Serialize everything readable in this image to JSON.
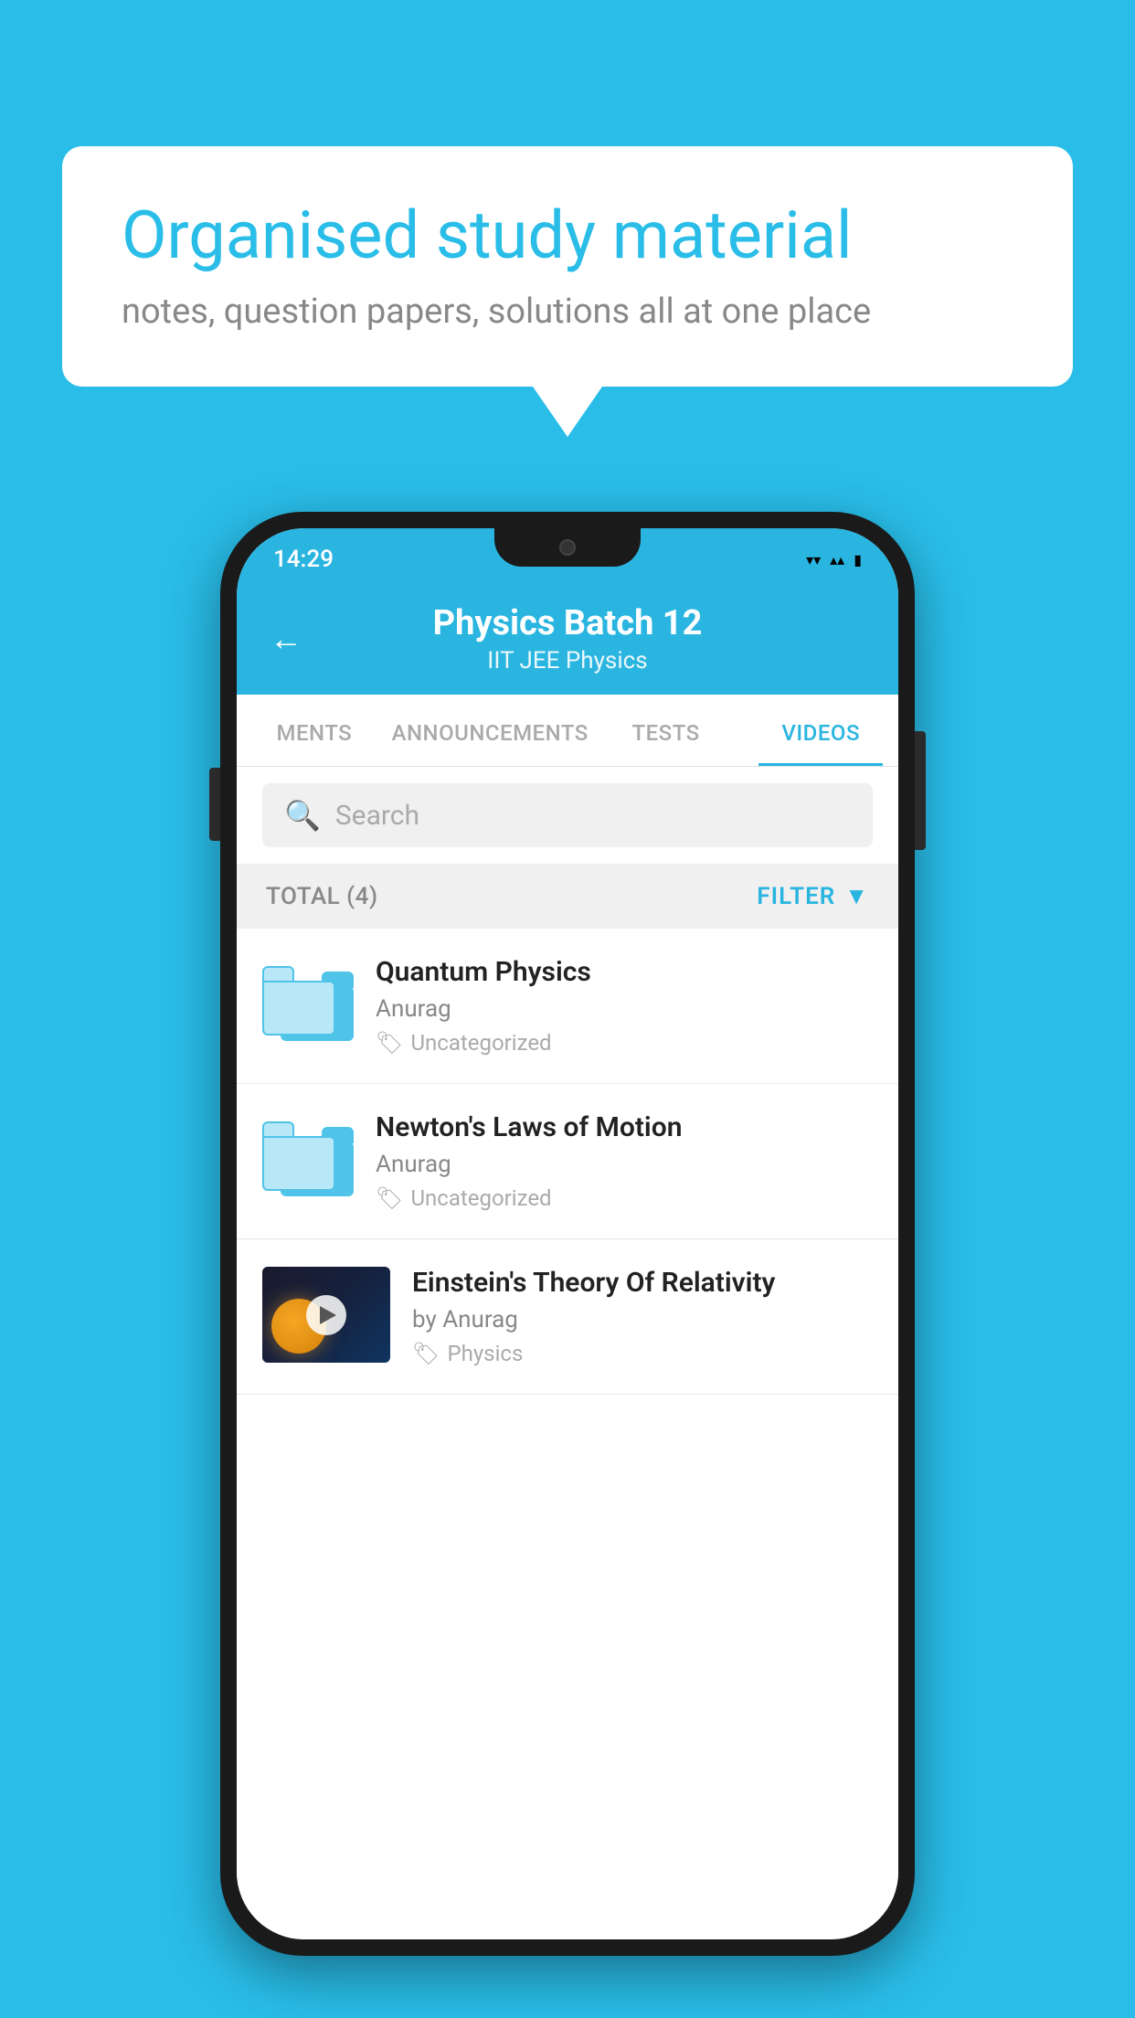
{
  "background": {
    "color": "#29bde8"
  },
  "speech_bubble": {
    "title": "Organised study material",
    "subtitle": "notes, question papers, solutions all at one place"
  },
  "phone": {
    "status_bar": {
      "time": "14:29",
      "wifi": "▾",
      "signal": "▴",
      "battery": "▮"
    },
    "header": {
      "back_icon": "←",
      "title": "Physics Batch 12",
      "subtitle_part1": "IIT JEE",
      "subtitle_sep": "   ",
      "subtitle_part2": "Physics"
    },
    "tabs": [
      {
        "label": "MENTS",
        "active": false
      },
      {
        "label": "ANNOUNCEMENTS",
        "active": false
      },
      {
        "label": "TESTS",
        "active": false
      },
      {
        "label": "VIDEOS",
        "active": true
      }
    ],
    "search": {
      "placeholder": "Search"
    },
    "filter_bar": {
      "total_label": "TOTAL (4)",
      "filter_label": "FILTER"
    },
    "videos": [
      {
        "id": 1,
        "title": "Quantum Physics",
        "author": "Anurag",
        "tag": "Uncategorized",
        "has_thumbnail": false
      },
      {
        "id": 2,
        "title": "Newton's Laws of Motion",
        "author": "Anurag",
        "tag": "Uncategorized",
        "has_thumbnail": false
      },
      {
        "id": 3,
        "title": "Einstein's Theory Of Relativity",
        "author": "by Anurag",
        "tag": "Physics",
        "has_thumbnail": true
      }
    ]
  }
}
